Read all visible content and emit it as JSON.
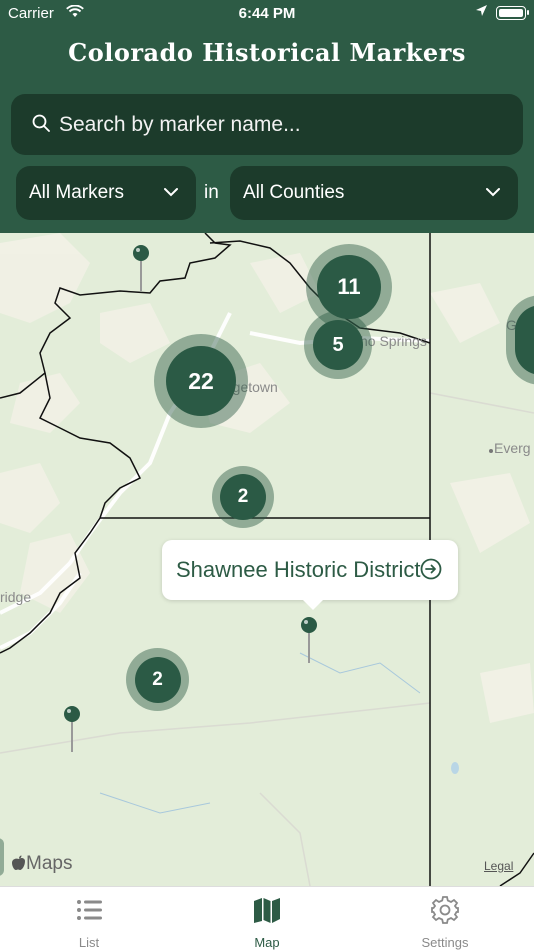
{
  "status_bar": {
    "carrier": "Carrier",
    "time": "6:44 PM"
  },
  "header": {
    "title": "Colorado Historical Markers"
  },
  "search": {
    "placeholder": "Search by marker name..."
  },
  "filters": {
    "marker_type": "All Markers",
    "connector": "in",
    "county": "All Counties"
  },
  "map": {
    "clusters": [
      {
        "count": "11"
      },
      {
        "count": "5"
      },
      {
        "count": "22"
      },
      {
        "count": "2"
      },
      {
        "count": "2"
      }
    ],
    "labels": [
      "rgetown",
      "ho Springs",
      "Everg",
      "ridge",
      "Go"
    ],
    "callout": {
      "name": "Shawnee Historic District"
    },
    "attribution": {
      "logo": "Maps",
      "legal": "Legal"
    }
  },
  "tab_bar": {
    "tabs": [
      {
        "label": "List",
        "icon": "list-icon"
      },
      {
        "label": "Map",
        "icon": "map-icon",
        "active": true
      },
      {
        "label": "Settings",
        "icon": "gear-icon"
      }
    ]
  },
  "colors": {
    "header": "#2d5b45",
    "control": "#1c3b2b",
    "accent": "#2d5b45"
  }
}
